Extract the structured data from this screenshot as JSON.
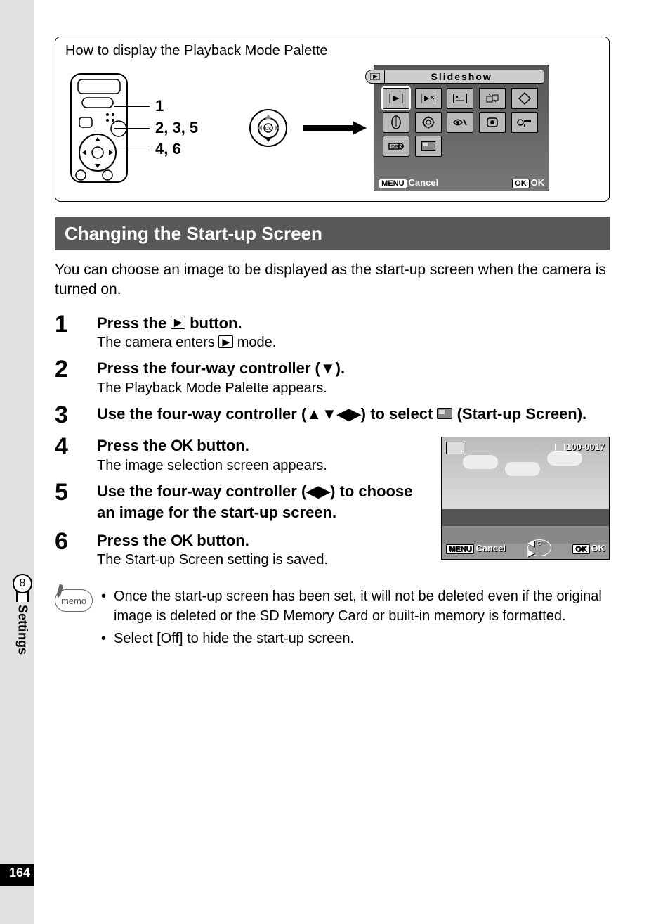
{
  "page_number": "164",
  "chapter": {
    "number": "8",
    "label": "Settings"
  },
  "box": {
    "title": "How to display the Playback Mode Palette",
    "step_refs": [
      "1",
      "2, 3, 5",
      "4, 6"
    ]
  },
  "lcd1": {
    "title": "Slideshow",
    "menu_label": "MENU",
    "cancel": "Cancel",
    "ok_label": "OK",
    "ok_text": "OK"
  },
  "section_title": "Changing the Start-up Screen",
  "intro": "You can choose an image to be displayed as the start-up screen when the camera is turned on.",
  "steps": [
    {
      "num": "1",
      "main_before": "Press the ",
      "main_after": " button.",
      "icon": "playback",
      "sub_before": "The camera enters ",
      "sub_after": " mode.",
      "sub_icon": "playback"
    },
    {
      "num": "2",
      "main": "Press the four-way controller (▼).",
      "sub": "The Playback Mode Palette appears."
    },
    {
      "num": "3",
      "main_before": "Use the four-way controller (▲▼◀▶) to select ",
      "main_after": " (Start-up Screen).",
      "icon": "startup"
    },
    {
      "num": "4",
      "main_before": "Press the ",
      "main_mid": "OK",
      "main_after": " button.",
      "sub": "The image selection screen appears."
    },
    {
      "num": "5",
      "main": "Use the four-way controller (◀▶) to choose an image for the start-up screen."
    },
    {
      "num": "6",
      "main_before": "Press the ",
      "main_mid": "OK",
      "main_after": " button.",
      "sub": "The Start-up Screen setting is saved."
    }
  ],
  "lcd2": {
    "file_number": "100-0017",
    "menu_label": "MENU",
    "cancel": "Cancel",
    "ok_label": "OK",
    "ok_text": "OK"
  },
  "memo": {
    "label": "memo",
    "items": [
      "Once the start-up screen has been set, it will not be deleted even if the original image is deleted or the SD Memory Card or built-in memory is formatted.",
      "Select [Off] to hide the start-up screen."
    ]
  }
}
